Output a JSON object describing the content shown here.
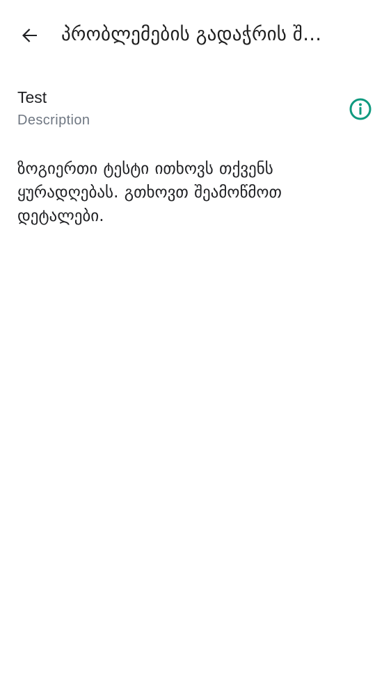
{
  "header": {
    "back_icon": "arrow-left-icon",
    "title": "პრობლემების გადაჭრის შ…"
  },
  "test": {
    "name": "Test",
    "description": "Description",
    "info_icon": "info-circle-icon"
  },
  "message": "ზოგიერთი ტესტი ითხოვს თქვენს ყურადღებას. გთხოვთ შეამოწმოთ დეტალები.",
  "colors": {
    "accent": "#0f9a7f",
    "text": "#202124",
    "secondary_text": "#6f7782",
    "background": "#ffffff"
  }
}
